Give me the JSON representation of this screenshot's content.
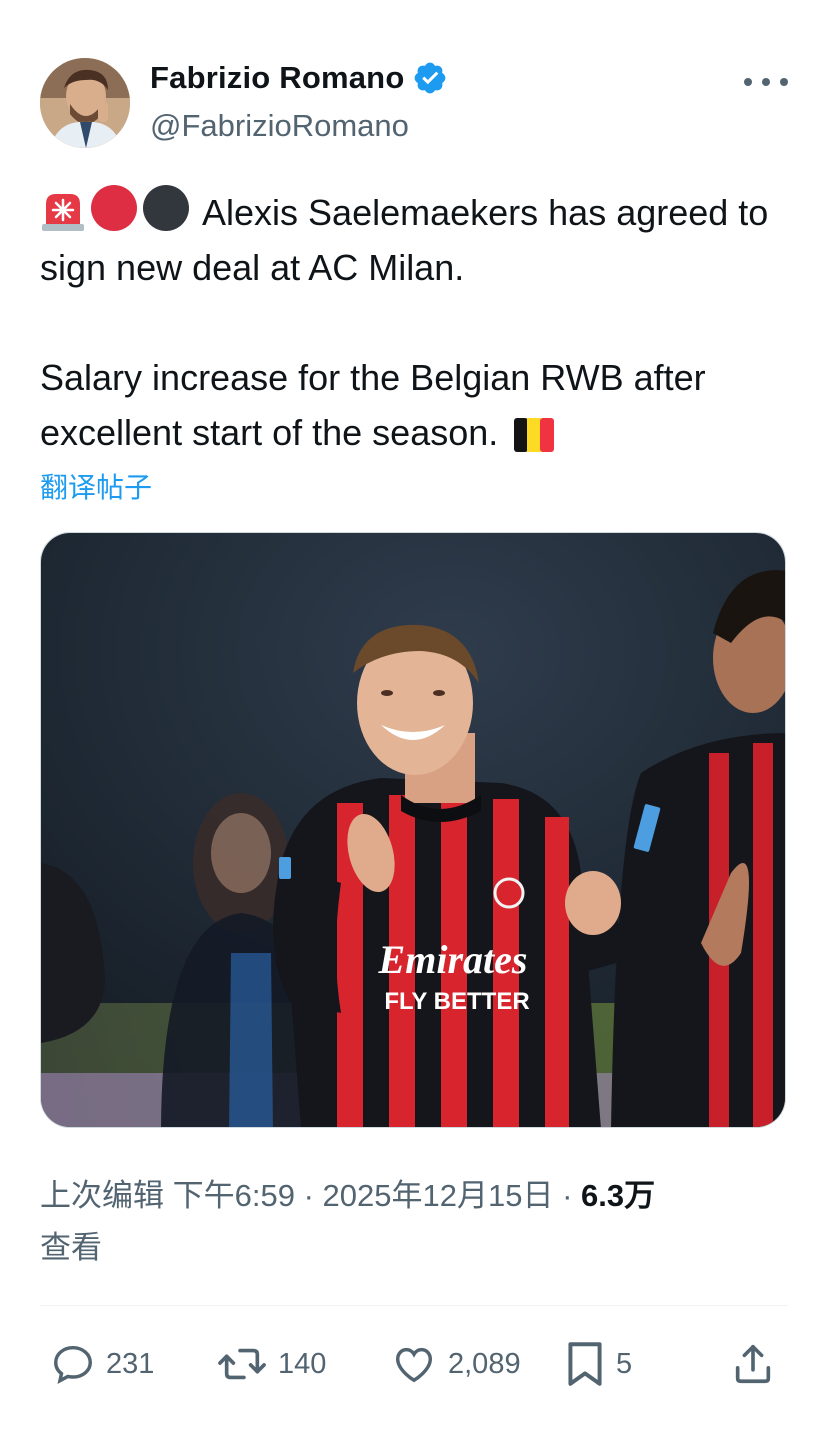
{
  "author": {
    "name": "Fabrizio Romano",
    "handle": "@FabrizioRomano",
    "verified": true
  },
  "tweet": {
    "emojis": [
      "rotating-light",
      "red-circle",
      "black-circle"
    ],
    "line1": "Alexis Saelemaekers has agreed to sign new deal at AC Milan.",
    "line2": "Salary increase for the Belgian RWB after excellent start of the season.",
    "flag": "belgium-flag",
    "translate_link": "翻译帖子"
  },
  "media": {
    "type": "photo",
    "sponsor": "Emirates",
    "sponsor_tagline": "FLY BETTER"
  },
  "meta": {
    "edited_label": "上次编辑",
    "time": "下午6:59",
    "date": "2025年12月15日",
    "views": "6.3万",
    "views_label": "查看"
  },
  "actions": {
    "replies": "231",
    "reposts": "140",
    "likes": "2,089",
    "bookmarks": "5"
  },
  "colors": {
    "accent": "#1d9bf0",
    "text": "#0f1419",
    "secondary": "#536471",
    "milan_red": "#d8242d"
  }
}
